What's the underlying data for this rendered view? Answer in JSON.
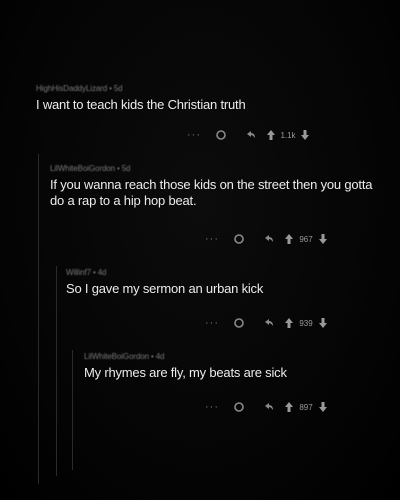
{
  "comments": [
    {
      "username": "HighHisDaddyLizard",
      "age": "5d",
      "text": "I want to teach kids the Christian truth",
      "score": "1.1k"
    },
    {
      "username": "LilWhiteBoiGordon",
      "age": "5d",
      "text": "If you wanna reach those kids on the street then you gotta do a rap to a hip hop beat.",
      "score": "967"
    },
    {
      "username": "Willinf7",
      "age": "4d",
      "text": "So I gave my sermon an urban kick",
      "score": "939"
    },
    {
      "username": "LilWhiteBoiGordon",
      "age": "4d",
      "text": "My rhymes are fly, my beats are sick",
      "score": "897"
    }
  ],
  "actions": {
    "more_label": "···"
  },
  "icons": {
    "award": "award-icon",
    "reply": "reply-icon",
    "upvote": "upvote-icon",
    "downvote": "downvote-icon"
  },
  "colors": {
    "background": "#000000",
    "text": "#ececec",
    "muted": "#7a7a7a",
    "icon": "#8a8a8a"
  }
}
